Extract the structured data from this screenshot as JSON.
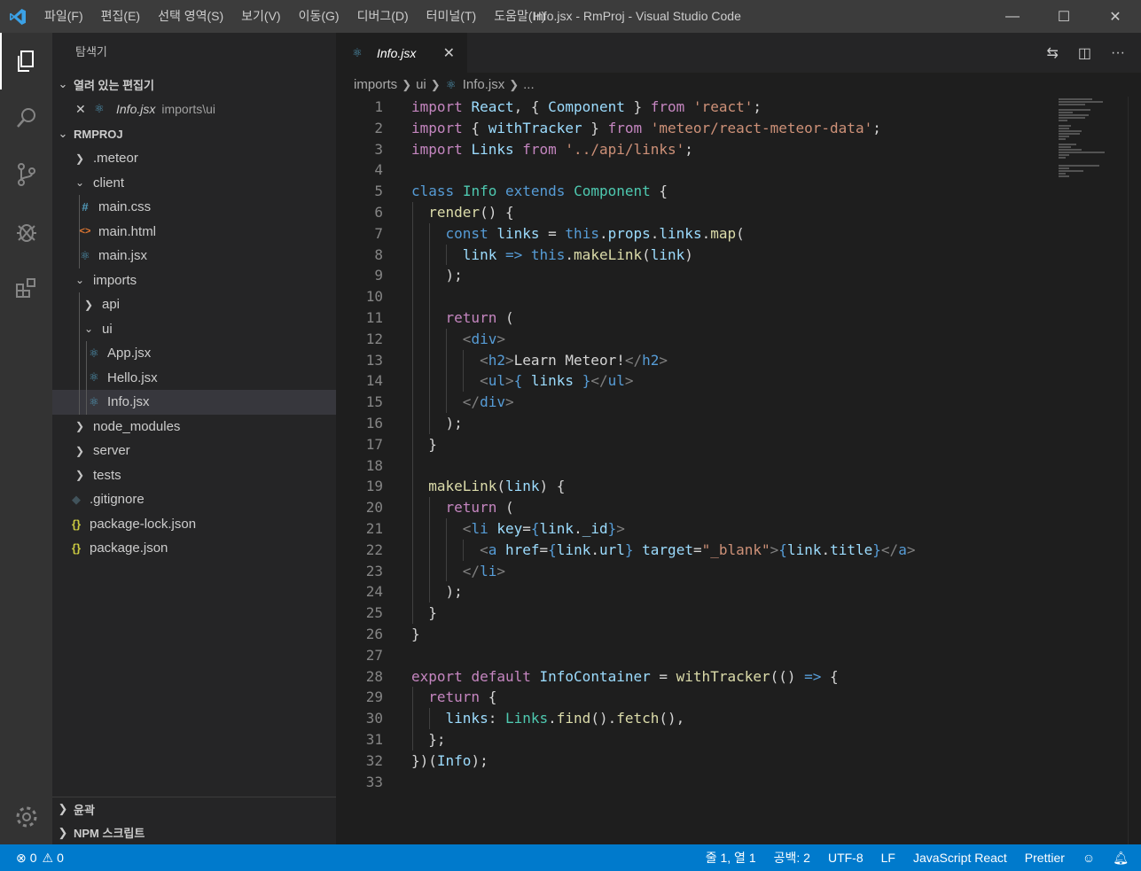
{
  "titlebar": {
    "window_title": "Info.jsx - RmProj - Visual Studio Code",
    "menu": [
      "파일(F)",
      "편집(E)",
      "선택 영역(S)",
      "보기(V)",
      "이동(G)",
      "디버그(D)",
      "터미널(T)",
      "도움말(H)"
    ]
  },
  "sidebar": {
    "title": "탐색기",
    "open_editors": {
      "header": "열려 있는 편집기",
      "items": [
        {
          "name": "Info.jsx",
          "path": "imports\\ui"
        }
      ]
    },
    "project": {
      "header": "RMPROJ",
      "tree": [
        {
          "label": ".meteor"
        },
        {
          "label": "client"
        },
        {
          "label": "main.css",
          "icon": "#"
        },
        {
          "label": "main.html",
          "icon": "<>"
        },
        {
          "label": "main.jsx"
        },
        {
          "label": "imports"
        },
        {
          "label": "api"
        },
        {
          "label": "ui"
        },
        {
          "label": "App.jsx"
        },
        {
          "label": "Hello.jsx"
        },
        {
          "label": "Info.jsx"
        },
        {
          "label": "node_modules"
        },
        {
          "label": "server"
        },
        {
          "label": "tests"
        },
        {
          "label": ".gitignore"
        },
        {
          "label": "package-lock.json",
          "icon": "{}"
        },
        {
          "label": "package.json",
          "icon": "{}"
        }
      ]
    },
    "footer": {
      "outline": "윤곽",
      "npm_scripts": "NPM 스크립트"
    }
  },
  "editor": {
    "tab": {
      "name": "Info.jsx"
    },
    "breadcrumbs": [
      "imports",
      "ui",
      "Info.jsx",
      "..."
    ]
  },
  "statusbar": {
    "errors": "0",
    "warnings": "0",
    "position": "줄 1, 열 1",
    "indent": "공백: 2",
    "encoding": "UTF-8",
    "eol": "LF",
    "language": "JavaScript React",
    "formatter": "Prettier"
  },
  "colors": {
    "statusbar": "#007acc",
    "activitybar": "#333333",
    "sidebar": "#252526",
    "editor": "#1e1e1e"
  }
}
